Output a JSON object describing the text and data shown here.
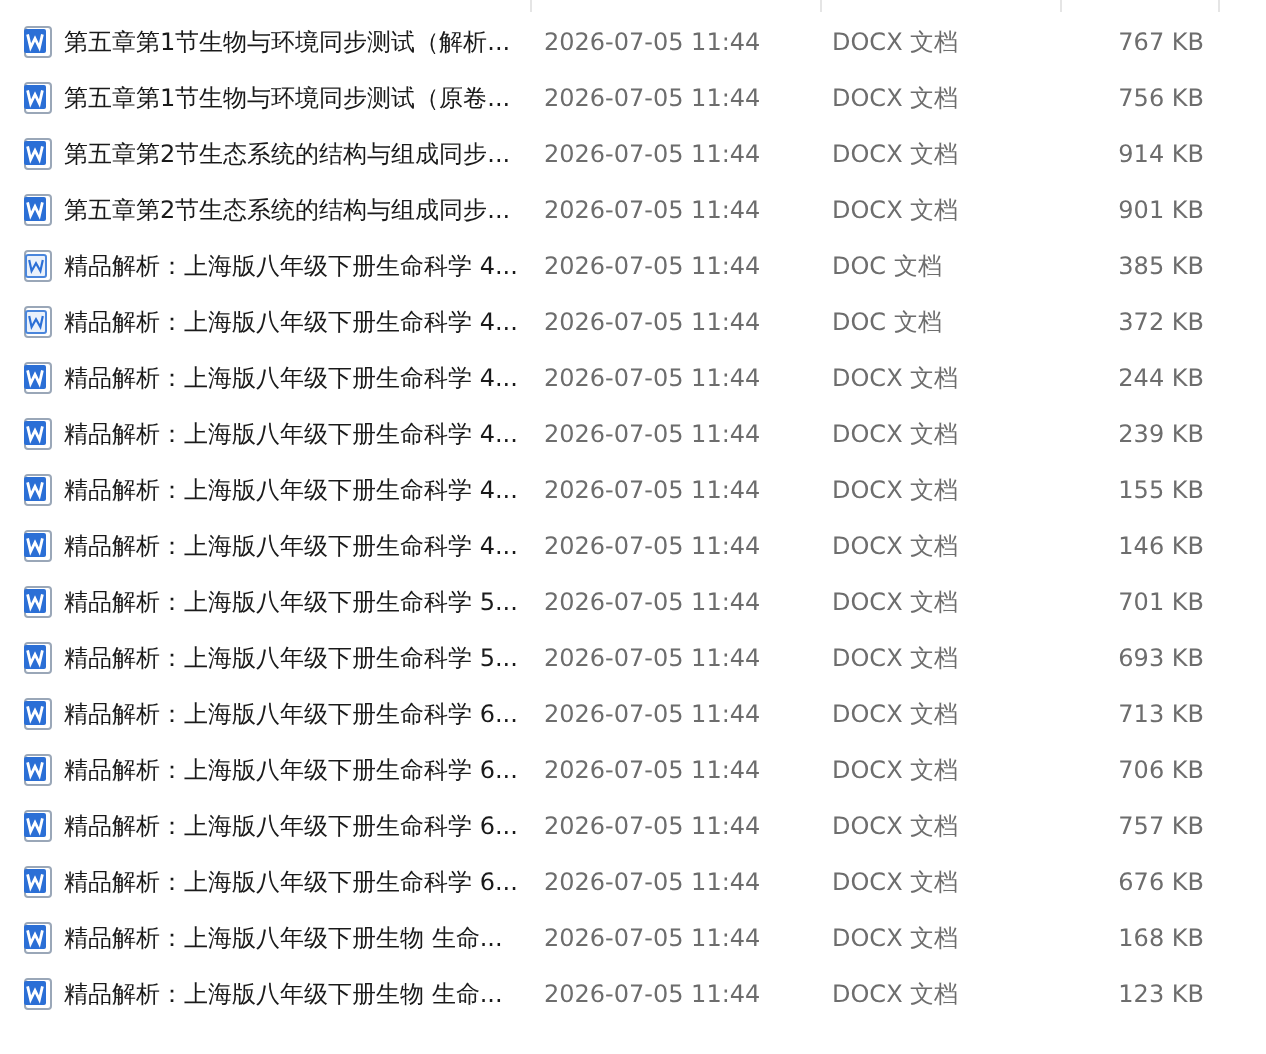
{
  "files": [
    {
      "name": "第五章第1节生物与环境同步测试（解析...",
      "kind": "docx",
      "modified": "2026-07-05 11:44",
      "type": "DOCX 文档",
      "size": "767 KB"
    },
    {
      "name": "第五章第1节生物与环境同步测试（原卷...",
      "kind": "docx",
      "modified": "2026-07-05 11:44",
      "type": "DOCX 文档",
      "size": "756 KB"
    },
    {
      "name": "第五章第2节生态系统的结构与组成同步...",
      "kind": "docx",
      "modified": "2026-07-05 11:44",
      "type": "DOCX 文档",
      "size": "914 KB"
    },
    {
      "name": "第五章第2节生态系统的结构与组成同步...",
      "kind": "docx",
      "modified": "2026-07-05 11:44",
      "type": "DOCX 文档",
      "size": "901 KB"
    },
    {
      "name": "精品解析：上海版八年级下册生命科学 4...",
      "kind": "doc",
      "modified": "2026-07-05 11:44",
      "type": "DOC 文档",
      "size": "385 KB"
    },
    {
      "name": "精品解析：上海版八年级下册生命科学 4...",
      "kind": "doc",
      "modified": "2026-07-05 11:44",
      "type": "DOC 文档",
      "size": "372 KB"
    },
    {
      "name": "精品解析：上海版八年级下册生命科学 4...",
      "kind": "docx",
      "modified": "2026-07-05 11:44",
      "type": "DOCX 文档",
      "size": "244 KB"
    },
    {
      "name": "精品解析：上海版八年级下册生命科学 4...",
      "kind": "docx",
      "modified": "2026-07-05 11:44",
      "type": "DOCX 文档",
      "size": "239 KB"
    },
    {
      "name": "精品解析：上海版八年级下册生命科学 4...",
      "kind": "docx",
      "modified": "2026-07-05 11:44",
      "type": "DOCX 文档",
      "size": "155 KB"
    },
    {
      "name": "精品解析：上海版八年级下册生命科学 4...",
      "kind": "docx",
      "modified": "2026-07-05 11:44",
      "type": "DOCX 文档",
      "size": "146 KB"
    },
    {
      "name": "精品解析：上海版八年级下册生命科学 5...",
      "kind": "docx",
      "modified": "2026-07-05 11:44",
      "type": "DOCX 文档",
      "size": "701 KB"
    },
    {
      "name": "精品解析：上海版八年级下册生命科学 5...",
      "kind": "docx",
      "modified": "2026-07-05 11:44",
      "type": "DOCX 文档",
      "size": "693 KB"
    },
    {
      "name": "精品解析：上海版八年级下册生命科学 6...",
      "kind": "docx",
      "modified": "2026-07-05 11:44",
      "type": "DOCX 文档",
      "size": "713 KB"
    },
    {
      "name": "精品解析：上海版八年级下册生命科学 6...",
      "kind": "docx",
      "modified": "2026-07-05 11:44",
      "type": "DOCX 文档",
      "size": "706 KB"
    },
    {
      "name": "精品解析：上海版八年级下册生命科学 6...",
      "kind": "docx",
      "modified": "2026-07-05 11:44",
      "type": "DOCX 文档",
      "size": "757 KB"
    },
    {
      "name": "精品解析：上海版八年级下册生命科学 6...",
      "kind": "docx",
      "modified": "2026-07-05 11:44",
      "type": "DOCX 文档",
      "size": "676 KB"
    },
    {
      "name": "精品解析：上海版八年级下册生物 生命...",
      "kind": "docx",
      "modified": "2026-07-05 11:44",
      "type": "DOCX 文档",
      "size": "168 KB"
    },
    {
      "name": "精品解析：上海版八年级下册生物 生命...",
      "kind": "docx",
      "modified": "2026-07-05 11:44",
      "type": "DOCX 文档",
      "size": "123 KB"
    }
  ]
}
